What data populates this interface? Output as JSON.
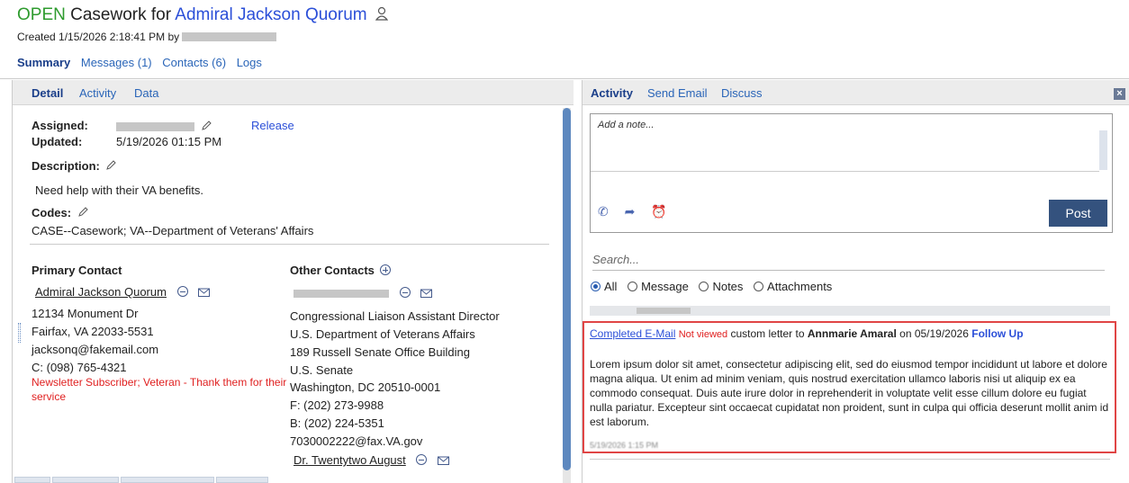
{
  "header": {
    "status": "OPEN",
    "title_prefix": "Casework for",
    "constituent": "Admiral Jackson Quorum",
    "created": "Created 1/15/2026 2:18:41 PM by",
    "tabs": [
      "Summary",
      "Messages (1)",
      "Contacts (6)",
      "Logs"
    ]
  },
  "left": {
    "subtabs": [
      "Detail",
      "Activity",
      "Data"
    ],
    "assigned_label": "Assigned:",
    "release": "Release",
    "updated_label": "Updated:",
    "updated_value": "5/19/2026 01:15 PM",
    "description_label": "Description:",
    "description": "Need help with their VA benefits.",
    "codes_label": "Codes:",
    "codes": "CASE--Casework; VA--Department of Veterans' Affairs",
    "primary": {
      "heading": "Primary Contact",
      "name": "Admiral Jackson Quorum",
      "lines": [
        "12134 Monument Dr",
        "Fairfax, VA 22033-5531",
        "jacksonq@fakemail.com",
        "C: (098) 765-4321"
      ],
      "note_line1": "Newsletter Subscriber; Veteran - Thank them for their",
      "note_line2": "service"
    },
    "other": {
      "heading": "Other Contacts",
      "lines": [
        "Congressional Liaison Assistant Director",
        "U.S. Department of Veterans Affairs",
        "189 Russell Senate Office Building",
        "U.S. Senate",
        "Washington, DC 20510-0001",
        "F: (202) 273-9988",
        "B: (202) 224-5351",
        "7030002222@fax.VA.gov"
      ],
      "second_name": "Dr. Twentytwo August"
    }
  },
  "right": {
    "tabs": [
      "Activity",
      "Send Email",
      "Discuss"
    ],
    "note_placeholder": "Add a note...",
    "post": "Post",
    "search_placeholder": "Search...",
    "filters": [
      "All",
      "Message",
      "Notes",
      "Attachments"
    ],
    "entry": {
      "link": "Completed E-Mail",
      "status": "Not viewed",
      "text": "custom letter to",
      "recipient": "Annmarie Amaral",
      "on": "on 05/19/2026",
      "follow": "Follow Up",
      "body": "Lorem ipsum dolor sit amet, consectetur adipiscing elit, sed do eiusmod tempor incididunt ut labore et dolore magna aliqua. Ut enim ad minim veniam, quis nostrud exercitation ullamco laboris nisi ut aliquip ex ea commodo consequat. Duis aute irure dolor in reprehenderit in voluptate velit esse cillum dolore eu fugiat nulla pariatur. Excepteur sint occaecat cupidatat non proident, sunt in culpa qui officia deserunt mollit anim id est laborum.",
      "timestamp": "5/19/2026 1:15 PM"
    }
  }
}
